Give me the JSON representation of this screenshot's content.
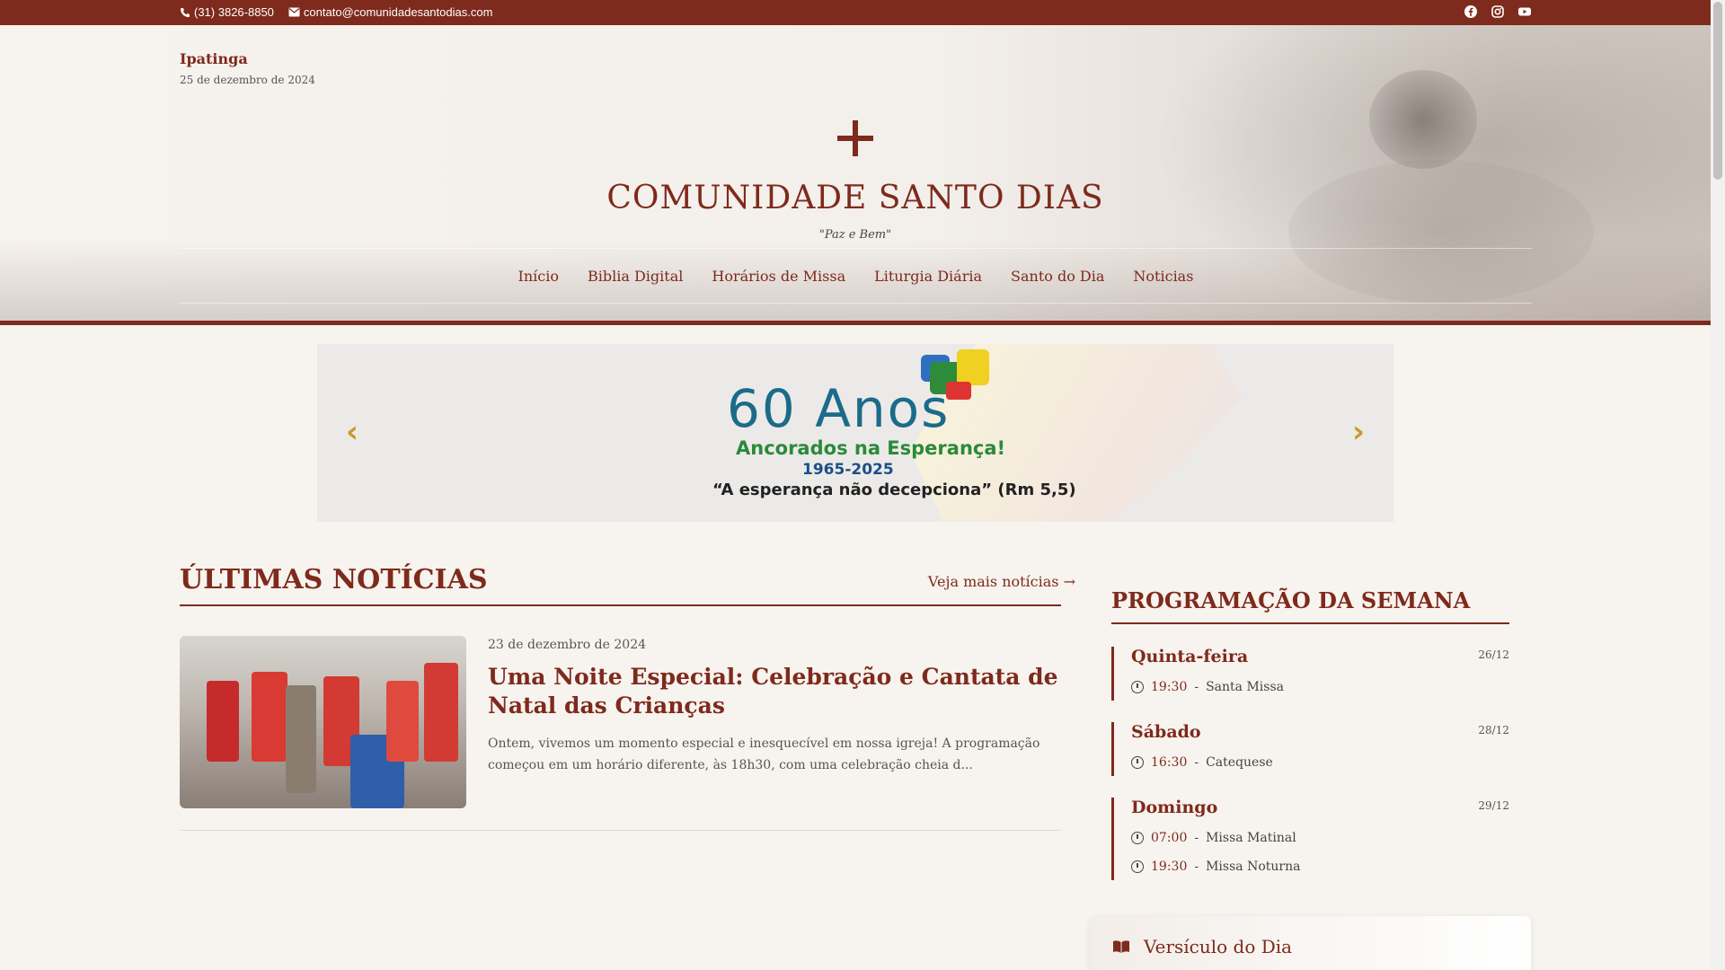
{
  "topbar": {
    "phone": "(31) 3826-8850",
    "email": "contato@comunidadesantodias.com",
    "social": [
      "facebook-icon",
      "instagram-icon",
      "youtube-icon"
    ]
  },
  "header": {
    "city": "Ipatinga",
    "date": "25 de dezembro de 2024",
    "site_title": "COMUNIDADE SANTO DIAS",
    "motto": "\"Paz e Bem\""
  },
  "nav": {
    "items": [
      "Início",
      "Biblia Digital",
      "Horários de Missa",
      "Liturgia Diária",
      "Santo do Dia",
      "Noticias"
    ]
  },
  "banner": {
    "big": "60 Anos",
    "subtitle": "Ancorados na Esperança!",
    "years": "1965-2025",
    "quote": "“A esperança não decepciona” (Rm 5,5)"
  },
  "news": {
    "title": "ÚLTIMAS NOTÍCIAS",
    "more_link": "Veja mais notícias →",
    "items": [
      {
        "date": "23 de dezembro de 2024",
        "headline": "Uma Noite Especial: Celebração e Cantata de Natal das Crianças",
        "excerpt": "Ontem, vivemos um momento especial e inesquecível em nossa igreja! A programação começou em um horário diferente, às 18h30, com uma celebração cheia d..."
      }
    ]
  },
  "schedule": {
    "title": "PROGRAMAÇÃO DA SEMANA",
    "days": [
      {
        "name": "Quinta-feira",
        "date": "26/12",
        "events": [
          {
            "time": "19:30",
            "label": "Santa Missa"
          }
        ]
      },
      {
        "name": "Sábado",
        "date": "28/12",
        "events": [
          {
            "time": "16:30",
            "label": "Catequese"
          }
        ]
      },
      {
        "name": "Domingo",
        "date": "29/12",
        "events": [
          {
            "time": "07:00",
            "label": "Missa Matinal"
          },
          {
            "time": "19:30",
            "label": "Missa Noturna"
          }
        ]
      }
    ]
  },
  "verse": {
    "title": "Versículo do Dia"
  },
  "colors": {
    "brand": "#7e2a1c",
    "accent": "#c79a2a",
    "background": "#f7f3ee"
  }
}
